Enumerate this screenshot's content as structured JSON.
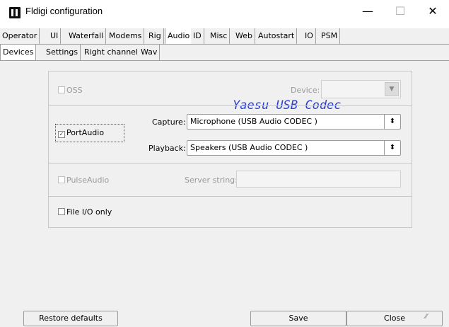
{
  "window": {
    "title": "Fldigi configuration",
    "minimize": "—",
    "maximize": "☐",
    "close": "✕"
  },
  "tabs_primary": [
    "Operator",
    "UI",
    "Waterfall",
    "Modems",
    "Rig",
    "Audio",
    "ID",
    "Misc",
    "Web",
    "Autostart",
    "IO",
    "PSM"
  ],
  "tabs_primary_active": "Audio",
  "tabs_secondary": [
    "Devices",
    "Settings",
    "Right channel",
    "Wav"
  ],
  "tabs_secondary_active": "Devices",
  "devices": {
    "oss_label": "OSS",
    "oss_checked": false,
    "device_label": "Device:",
    "device_value": "",
    "annotation": "Yaesu USB Codec",
    "portaudio_label": "PortAudio",
    "portaudio_checked": true,
    "capture_label": "Capture:",
    "capture_value": "Microphone (USB Audio CODEC )",
    "playback_label": "Playback:",
    "playback_value": "Speakers (USB Audio CODEC )",
    "pulseaudio_label": "PulseAudio",
    "pulseaudio_checked": false,
    "server_string_label": "Server string:",
    "server_string_value": "",
    "fileio_label": "File I/O only",
    "fileio_checked": false
  },
  "buttons": {
    "restore_defaults": "Restore defaults",
    "save": "Save",
    "close": "Close"
  },
  "colors": {
    "annotation": "#2a3fcf",
    "panel_bg": "#f0f0f0"
  }
}
